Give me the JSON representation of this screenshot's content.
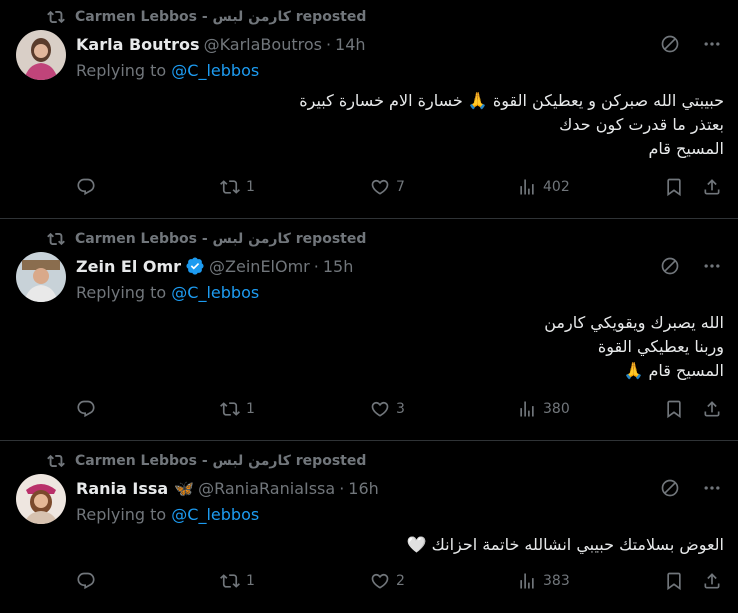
{
  "tweets": [
    {
      "reposted_by": "Carmen Lebbos - كارمن لبس reposted",
      "name": "Karla Boutros",
      "verified": false,
      "emoji": "",
      "handle": "@KarlaBoutros",
      "time": "14h",
      "replying_label": "Replying to",
      "replying_to": "@C_lebbos",
      "body_lines": [
        "حبيبتي الله صبركن و يعطيكن القوة 🙏 خسارة الام خسارة كبيرة",
        "بعتذر ما قدرت كون حدك",
        "المسيح قام"
      ],
      "replies": "",
      "reposts": "1",
      "likes": "7",
      "views": "402"
    },
    {
      "reposted_by": "Carmen Lebbos - كارمن لبس reposted",
      "name": "Zein El Omr",
      "verified": true,
      "emoji": "",
      "handle": "@ZeinElOmr",
      "time": "15h",
      "replying_label": "Replying to",
      "replying_to": "@C_lebbos",
      "body_lines": [
        "الله يصبرك ويقويكي كارمن",
        "وربنا يعطيكي القوة",
        "المسيح قام 🙏"
      ],
      "replies": "",
      "reposts": "1",
      "likes": "3",
      "views": "380"
    },
    {
      "reposted_by": "Carmen Lebbos - كارمن لبس reposted",
      "name": "Rania Issa",
      "verified": false,
      "emoji": "🦋",
      "handle": "@RaniaRaniaIssa",
      "time": "16h",
      "replying_label": "Replying to",
      "replying_to": "@C_lebbos",
      "body_lines": [
        "العوض بسلامتك حبيبي انشالله خاتمة احزانك 🤍"
      ],
      "replies": "",
      "reposts": "1",
      "likes": "2",
      "views": "383"
    }
  ],
  "colors": {
    "background": "#000000",
    "text": "#e7e9ea",
    "muted": "#71767b",
    "accent": "#1d9bf0",
    "divider": "#2f3336"
  },
  "icons": [
    "repost-icon",
    "grok-icon",
    "more-icon",
    "reply-icon",
    "retweet-icon",
    "like-icon",
    "views-icon",
    "bookmark-icon",
    "share-icon",
    "verified-icon"
  ]
}
